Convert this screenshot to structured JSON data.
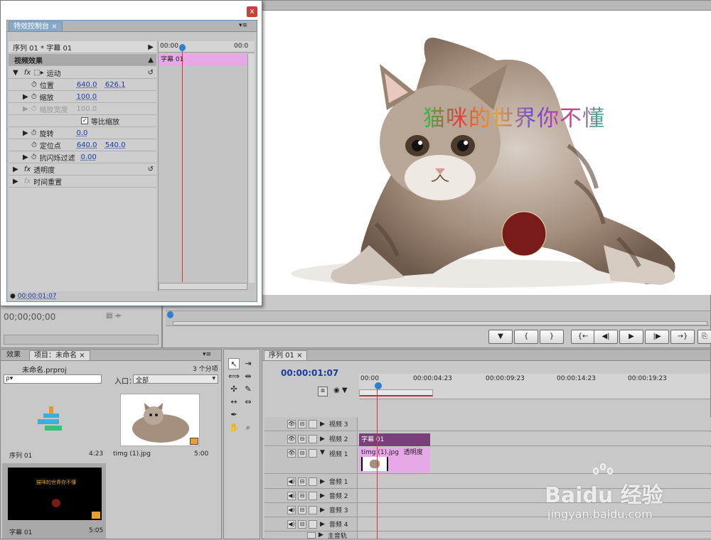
{
  "effect_controls": {
    "close_label": "x",
    "tab_title": "特效控制台",
    "menu_glyph": "▾≡",
    "sequence_label": "序列 01 * 字幕 01",
    "mini_ruler": [
      "00:00",
      "00:0"
    ],
    "clip_label": "字幕 01",
    "section_video": "视频效果",
    "motion": {
      "name": "运动",
      "position_label": "位置",
      "position_x": "640.0",
      "position_y": "626.1",
      "scale_label": "缩放",
      "scale": "100.0",
      "scale_width_label": "缩放宽度",
      "scale_width": "100.0",
      "uniform_label": "等比缩放",
      "rotation_label": "旋转",
      "rotation": "0.0",
      "anchor_label": "定位点",
      "anchor_x": "640.0",
      "anchor_y": "540.0",
      "flicker_label": "抗闪烁过滤",
      "flicker": "0.00"
    },
    "opacity_label": "透明度",
    "time_remap_label": "时间重置",
    "footer_time": "00:00:01:07"
  },
  "program_monitor": {
    "overlay_text": "猫咪的世界你不懂",
    "source_time": "00;00;00;00"
  },
  "project_panel": {
    "tab_effects": "效果",
    "tab_project": "项目：未命名",
    "filename": "未命名.prproj",
    "item_count": "3 个分项",
    "search_placeholder": "ρ▾",
    "entry_label": "入口：",
    "entry_value": "全部",
    "items": [
      {
        "name": "序列 01",
        "duration": "4:23"
      },
      {
        "name": "timg (1).jpg",
        "duration": "5:00"
      },
      {
        "name": "字幕 01",
        "duration": "5:05",
        "thumb_text": "猫咪的世界你不懂"
      }
    ]
  },
  "timeline": {
    "tab": "序列 01",
    "timecode": "00:00:01:07",
    "ruler": [
      "00:00",
      "00:00:04:23",
      "00:00:09:23",
      "00:00:14:23",
      "00:00:19:23"
    ],
    "video_tracks": [
      "视频 3",
      "视频 2",
      "视频 1"
    ],
    "audio_tracks": [
      "音频 1",
      "音频 2",
      "音频 3",
      "音频 4"
    ],
    "master_track": "主音轨",
    "clip_title": "字幕 01",
    "clip_image": "timg (1).jpg",
    "clip_opacity": "透明度"
  },
  "watermark": {
    "brand": "Baidu 经验",
    "url": "jingyan.baidu.com"
  },
  "colors": {
    "clip_pink": "#e6a8e6",
    "clip_title_bar": "#7a3f7a",
    "playhead": "#e03030",
    "timecode_blue": "#1a3a9e"
  }
}
